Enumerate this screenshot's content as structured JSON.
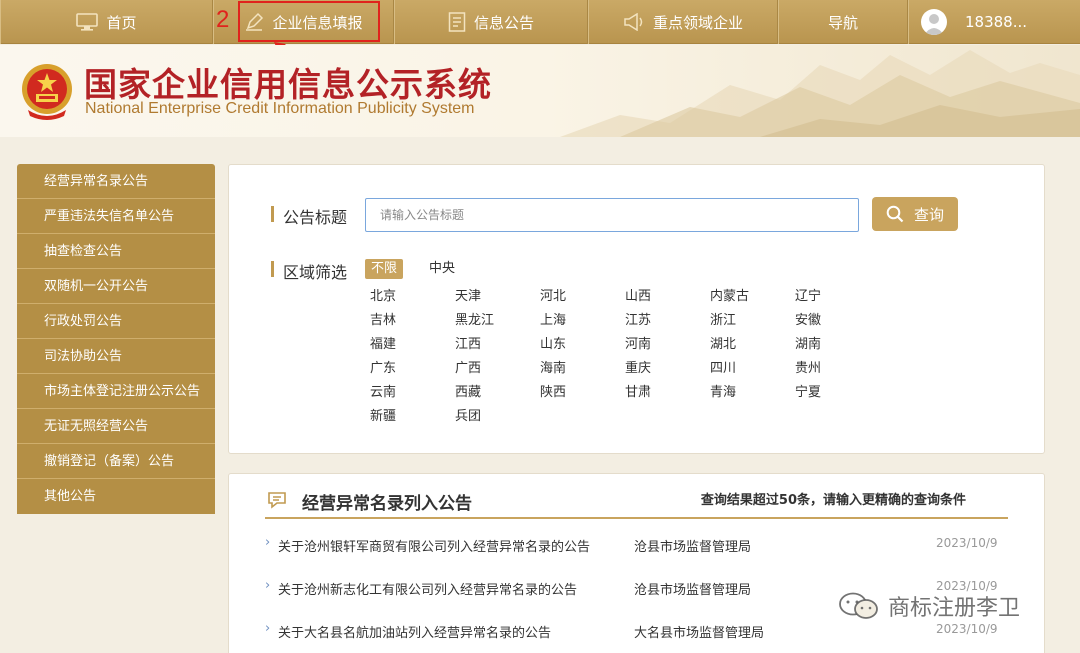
{
  "annotation": {
    "step_number": "2",
    "accent": "#e0231d"
  },
  "nav": {
    "items": [
      {
        "label": "首页",
        "icon": "monitor-icon"
      },
      {
        "label": "企业信息填报",
        "icon": "pen-icon"
      },
      {
        "label": "信息公告",
        "icon": "document-icon"
      },
      {
        "label": "重点领域企业",
        "icon": "megaphone-icon"
      },
      {
        "label": "导航",
        "icon": ""
      }
    ],
    "user": {
      "name": "18388...",
      "icon": "user-avatar-icon"
    }
  },
  "header": {
    "title_cn": "国家企业信用信息公示系统",
    "title_en": "National Enterprise Credit Information Publicity System"
  },
  "sidebar": {
    "items": [
      "经营异常名录公告",
      "严重违法失信名单公告",
      "抽查检查公告",
      "双随机一公开公告",
      "行政处罚公告",
      "司法协助公告",
      "市场主体登记注册公示公告",
      "无证无照经营公告",
      "撤销登记（备案）公告",
      "其他公告"
    ]
  },
  "search": {
    "title_label": "公告标题",
    "placeholder": "请输入公告标题",
    "button_label": "查询",
    "region_label": "区域筛选",
    "region_selected": "不限",
    "region_center": "中央",
    "regions": [
      "北京",
      "天津",
      "河北",
      "山西",
      "内蒙古",
      "辽宁",
      "吉林",
      "黑龙江",
      "上海",
      "江苏",
      "浙江",
      "安徽",
      "福建",
      "江西",
      "山东",
      "河南",
      "湖北",
      "湖南",
      "广东",
      "广西",
      "海南",
      "重庆",
      "四川",
      "贵州",
      "云南",
      "西藏",
      "陕西",
      "甘肃",
      "青海",
      "宁夏",
      "新疆",
      "兵团"
    ]
  },
  "notices": {
    "section_title": "经营异常名录列入公告",
    "note": "查询结果超过50条，请输入更精确的查询条件",
    "rows": [
      {
        "title": "关于沧州银轩军商贸有限公司列入经营异常名录的公告",
        "org": "沧县市场监督管理局",
        "date": "2023/10/9"
      },
      {
        "title": "关于沧州新志化工有限公司列入经营异常名录的公告",
        "org": "沧县市场监督管理局",
        "date": "2023/10/9"
      },
      {
        "title": "关于大名县名航加油站列入经营异常名录的公告",
        "org": "大名县市场监督管理局",
        "date": "2023/10/9"
      }
    ]
  },
  "watermark": {
    "text": "商标注册李卫",
    "icon": "wechat-icon"
  },
  "colors": {
    "gold": "#b48f45",
    "gold_light": "#c9a45e",
    "title_red": "#b32226"
  }
}
